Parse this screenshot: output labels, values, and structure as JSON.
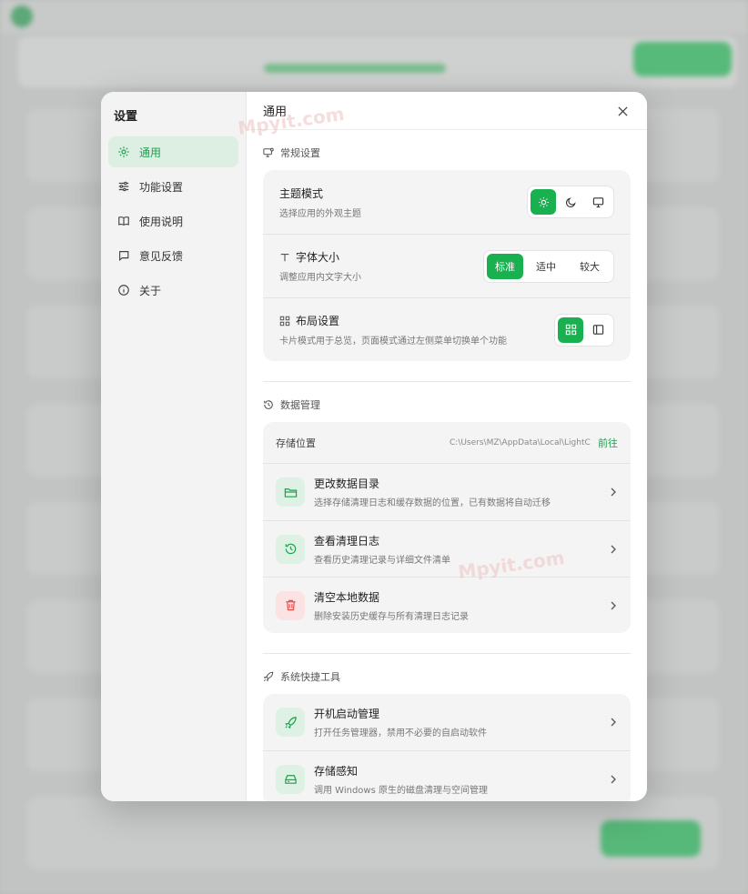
{
  "sidebar": {
    "title": "设置",
    "items": [
      {
        "label": "通用",
        "icon": "gear-icon",
        "active": true
      },
      {
        "label": "功能设置",
        "icon": "sliders-icon",
        "active": false
      },
      {
        "label": "使用说明",
        "icon": "book-icon",
        "active": false
      },
      {
        "label": "意见反馈",
        "icon": "chat-icon",
        "active": false
      },
      {
        "label": "关于",
        "icon": "info-icon",
        "active": false
      }
    ]
  },
  "header": {
    "title": "通用"
  },
  "general": {
    "section_title": "常规设置",
    "theme": {
      "title": "主题模式",
      "desc": "选择应用的外观主题",
      "options": [
        "sun-icon",
        "moon-icon",
        "monitor-icon"
      ],
      "selected": "sun-icon"
    },
    "font": {
      "title": "字体大小",
      "desc": "调整应用内文字大小",
      "options": [
        "标准",
        "适中",
        "较大"
      ],
      "selected": "标准"
    },
    "layout": {
      "title": "布局设置",
      "desc": "卡片模式用于总览，页面模式通过左侧菜单切换单个功能",
      "options": [
        "grid-icon",
        "panel-icon"
      ],
      "selected": "grid-icon"
    }
  },
  "data": {
    "section_title": "数据管理",
    "storage_label": "存储位置",
    "storage_path": "C:\\Users\\MZ\\AppData\\Local\\LightC",
    "go_label": "前往",
    "items": [
      {
        "title": "更改数据目录",
        "desc": "选择存储清理日志和缓存数据的位置，已有数据将自动迁移",
        "icon": "folder-icon"
      },
      {
        "title": "查看清理日志",
        "desc": "查看历史清理记录与详细文件清单",
        "icon": "history-icon"
      },
      {
        "title": "清空本地数据",
        "desc": "删除安装历史缓存与所有清理日志记录",
        "icon": "trash-icon"
      }
    ]
  },
  "tools": {
    "section_title": "系统快捷工具",
    "items": [
      {
        "title": "开机启动管理",
        "desc": "打开任务管理器，禁用不必要的自启动软件",
        "icon": "rocket-icon"
      },
      {
        "title": "存储感知",
        "desc": "调用 Windows 原生的磁盘清理与空间管理",
        "icon": "drive-icon"
      }
    ]
  },
  "watermark": "Mpyit.com",
  "colors": {
    "accent": "#19b150",
    "danger": "#e05252"
  }
}
